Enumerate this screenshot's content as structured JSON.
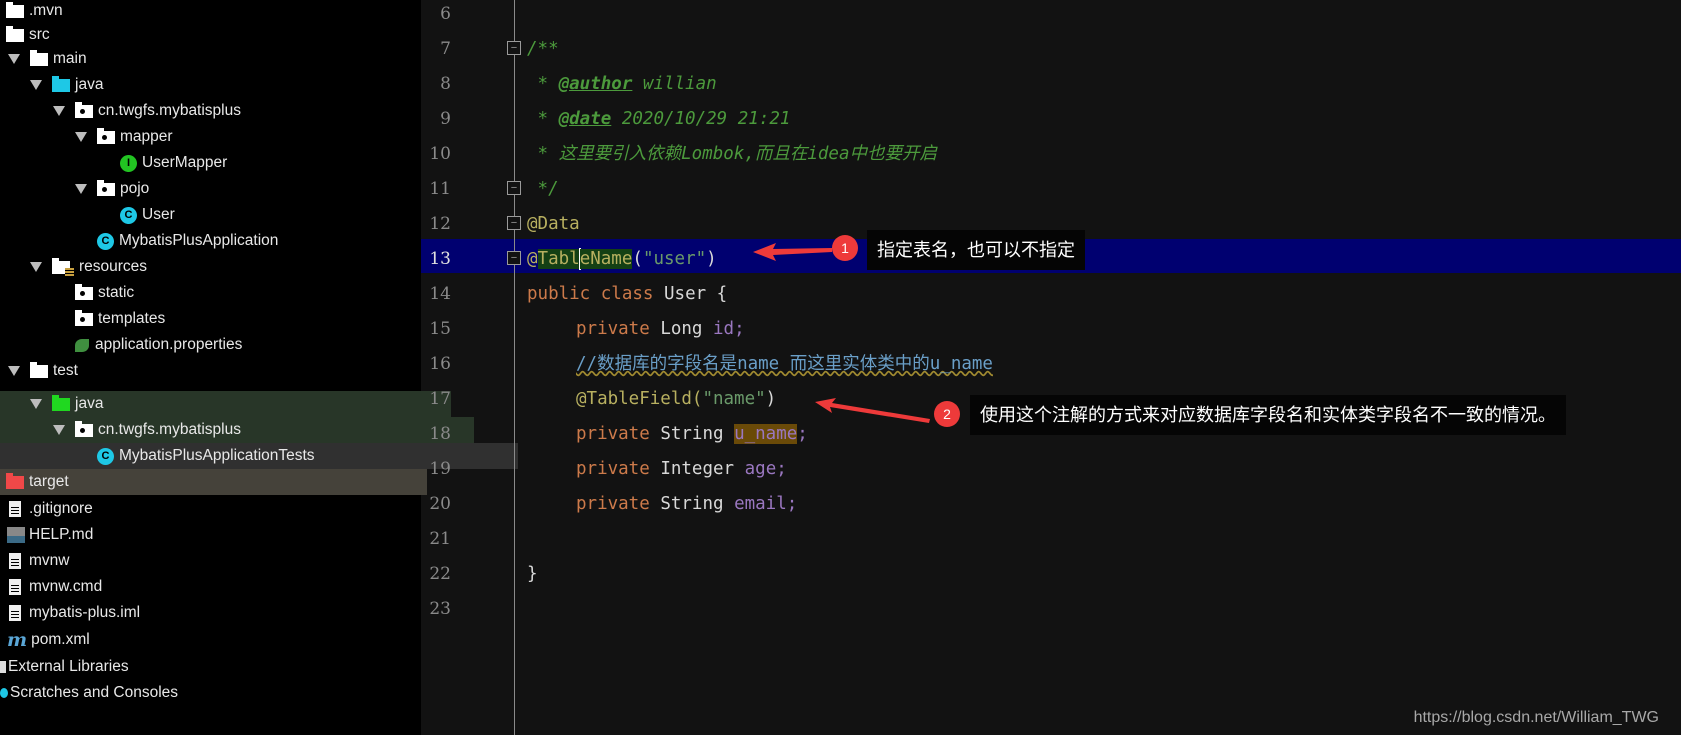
{
  "project_tree": {
    "items": [
      {
        "label": ".mvn",
        "icon": "folder-icon"
      },
      {
        "label": "src",
        "icon": "folder-icon"
      },
      {
        "label": "main",
        "icon": "folder-icon",
        "expanded": true
      },
      {
        "label": "java",
        "icon": "source-folder-icon",
        "expanded": true
      },
      {
        "label": "cn.twgfs.mybatisplus",
        "icon": "package-icon",
        "expanded": true
      },
      {
        "label": "mapper",
        "icon": "package-icon",
        "expanded": true
      },
      {
        "label": "UserMapper",
        "icon": "interface-icon",
        "icon_glyph": "I"
      },
      {
        "label": "pojo",
        "icon": "package-icon",
        "expanded": true
      },
      {
        "label": "User",
        "icon": "class-icon",
        "icon_glyph": "C"
      },
      {
        "label": "MybatisPlusApplication",
        "icon": "spring-boot-class-icon",
        "icon_glyph": "C"
      },
      {
        "label": "resources",
        "icon": "resources-folder-icon",
        "expanded": true
      },
      {
        "label": "static",
        "icon": "package-icon"
      },
      {
        "label": "templates",
        "icon": "package-icon"
      },
      {
        "label": "application.properties",
        "icon": "spring-properties-icon"
      },
      {
        "label": "test",
        "icon": "folder-icon",
        "expanded": true
      },
      {
        "label": "java",
        "icon": "test-source-folder-icon",
        "expanded": true
      },
      {
        "label": "cn.twgfs.mybatisplus",
        "icon": "package-icon",
        "expanded": true
      },
      {
        "label": "MybatisPlusApplicationTests",
        "icon": "test-class-icon",
        "icon_glyph": "C"
      },
      {
        "label": "target",
        "icon": "excluded-folder-icon"
      },
      {
        "label": ".gitignore",
        "icon": "text-file-icon"
      },
      {
        "label": "HELP.md",
        "icon": "markdown-file-icon"
      },
      {
        "label": "mvnw",
        "icon": "text-file-icon"
      },
      {
        "label": "mvnw.cmd",
        "icon": "text-file-icon"
      },
      {
        "label": "mybatis-plus.iml",
        "icon": "module-file-icon"
      },
      {
        "label": "pom.xml",
        "icon": "maven-icon",
        "icon_glyph": "m"
      },
      {
        "label": "External Libraries",
        "icon": "library-icon"
      },
      {
        "label": "Scratches and Consoles",
        "icon": "scratches-icon"
      }
    ]
  },
  "editor": {
    "line_numbers": [
      "6",
      "7",
      "8",
      "9",
      "10",
      "11",
      "12",
      "13",
      "14",
      "15",
      "16",
      "17",
      "18",
      "19",
      "20",
      "21",
      "22",
      "23"
    ],
    "current_line": "13",
    "code": {
      "l7": "/**",
      "l8_star": " * ",
      "l8_tag": "@author",
      "l8_text": " willian",
      "l9_star": " * ",
      "l9_tag": "@date",
      "l9_text": " 2020/10/29 21:21",
      "l10": " * 这里要引入依赖Lombok,而且在idea中也要开启",
      "l11": " */",
      "l12": "@Data",
      "l13_at": "@",
      "l13_a": "Tabl",
      "l13_b": "eName",
      "l13_paren_open": "(",
      "l13_str": "\"user\"",
      "l13_paren_close": ")",
      "l14_kw1": "public",
      "l14_kw2": "class",
      "l14_name": "User {",
      "l15_kw": "private",
      "l15_type": "Long",
      "l15_field": "id;",
      "l16": "//数据库的字段名是name 而这里实体类中的u_name",
      "l17_ann": "@TableField(",
      "l17_str": "\"name\"",
      "l17_close": ")",
      "l18_kw": "private",
      "l18_type": "String",
      "l18_field": "u_name",
      "l18_semi": ";",
      "l19_kw": "private",
      "l19_type": "Integer",
      "l19_field": "age;",
      "l20_kw": "private",
      "l20_type": "String",
      "l20_field": "email;",
      "l22": "}"
    }
  },
  "annotations": [
    {
      "number": "1",
      "text": "指定表名，也可以不指定"
    },
    {
      "number": "2",
      "text": "使用这个注解的方式来对应数据库字段名和实体类字段名不一致的情况。"
    }
  ],
  "watermark": "https://blog.csdn.net/William_TWG",
  "colors": {
    "current_line_bg": "#000070",
    "annotation_badge": "#ee3a3a",
    "keyword": "#cc7a4a",
    "doc_comment": "#4c9a3c",
    "field": "#9a77c0"
  }
}
